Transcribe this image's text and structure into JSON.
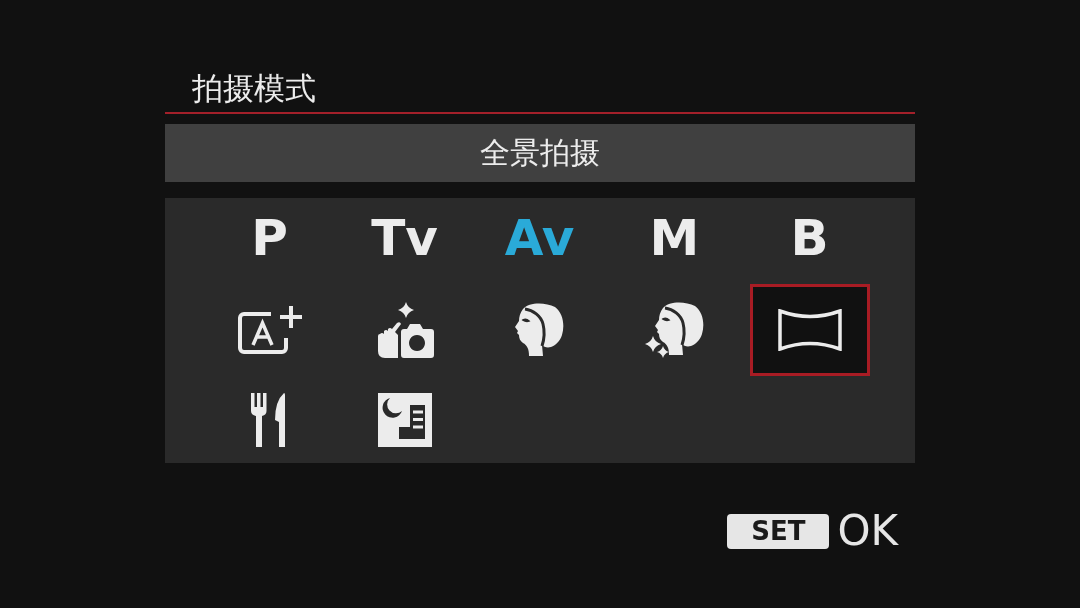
{
  "title": "拍摄模式",
  "mode_name": "全景拍摄",
  "modes": [
    {
      "kind": "letter",
      "label": "P",
      "active": false,
      "selected": false
    },
    {
      "kind": "letter",
      "label": "Tv",
      "active": false,
      "selected": false
    },
    {
      "kind": "letter",
      "label": "Av",
      "active": true,
      "selected": false
    },
    {
      "kind": "letter",
      "label": "M",
      "active": false,
      "selected": false
    },
    {
      "kind": "letter",
      "label": "B",
      "active": false,
      "selected": false
    },
    {
      "kind": "autoplus",
      "active": false,
      "selected": false
    },
    {
      "kind": "creative",
      "active": false,
      "selected": false
    },
    {
      "kind": "portrait",
      "active": false,
      "selected": false
    },
    {
      "kind": "smoothskin",
      "active": false,
      "selected": false
    },
    {
      "kind": "panorama",
      "active": false,
      "selected": true
    },
    {
      "kind": "food",
      "active": false,
      "selected": false
    },
    {
      "kind": "nightportrait",
      "active": false,
      "selected": false
    }
  ],
  "hint": {
    "key": "SET",
    "action": "OK"
  }
}
